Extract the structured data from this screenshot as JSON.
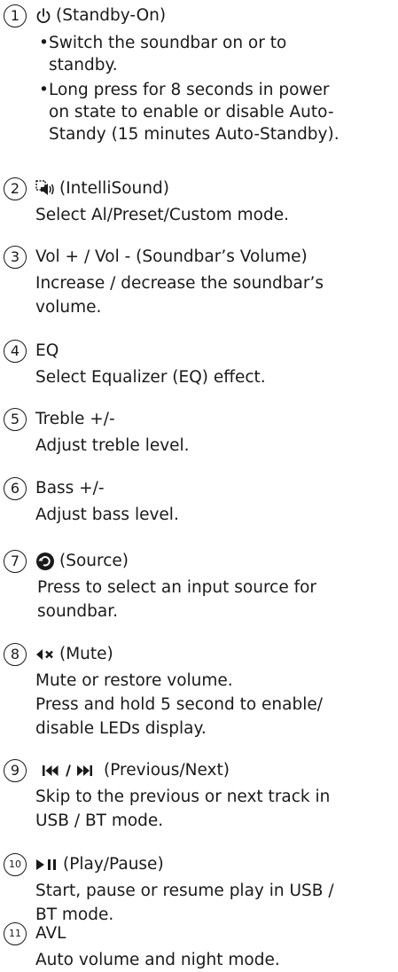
{
  "items": [
    {
      "number": "1",
      "icon": "power-icon",
      "title": "(Standby-On)",
      "bullets": [
        [
          "Switch the soundbar on or to",
          "standby."
        ],
        [
          "Long press for 8 seconds in power",
          "on state to enable or disable Auto-",
          "Standy (15 minutes Auto-Standby)."
        ]
      ]
    },
    {
      "number": "2",
      "icon": "intellisound-icon",
      "title": "(IntelliSound)",
      "description": [
        "Select Al/Preset/Custom mode."
      ]
    },
    {
      "number": "3",
      "title": "Vol + / Vol - (Soundbar’s Volume)",
      "description": [
        "Increase / decrease the soundbar’s",
        "volume."
      ]
    },
    {
      "number": "4",
      "title": "EQ",
      "description": [
        "Select Equalizer (EQ) effect."
      ]
    },
    {
      "number": "5",
      "title": "Treble +/-",
      "description": [
        "Adjust treble level."
      ]
    },
    {
      "number": "6",
      "title": "Bass +/-",
      "description": [
        "Adjust bass level."
      ]
    },
    {
      "number": "7",
      "icon": "source-icon",
      "title": "(Source)",
      "description": [
        "Press to select an input source for",
        "soundbar."
      ]
    },
    {
      "number": "8",
      "icon": "mute-icon",
      "title": "(Mute)",
      "description": [
        "Mute or restore volume.",
        "Press and hold  5 second to enable/",
        "disable LEDs display."
      ]
    },
    {
      "number": "9",
      "icon": "previous-next-icon",
      "title": "(Previous/Next)",
      "description": [
        "Skip to the previous or next track in",
        "USB / BT mode."
      ]
    },
    {
      "number": "10",
      "icon": "play-pause-icon",
      "title": "(Play/Pause)",
      "description": [
        "Start, pause or resume play in USB /",
        "BT mode."
      ]
    },
    {
      "number": "11",
      "title": "AVL",
      "description": [
        "Auto volume and night mode."
      ]
    }
  ]
}
